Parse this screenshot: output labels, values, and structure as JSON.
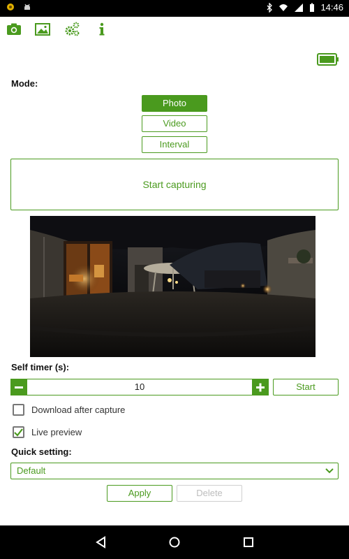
{
  "status_bar": {
    "time": "14:46"
  },
  "toolbar": {
    "icons": [
      "camera-icon",
      "gallery-icon",
      "settings-icon",
      "info-icon"
    ]
  },
  "mode": {
    "label": "Mode:",
    "options": [
      "Photo",
      "Video",
      "Interval"
    ],
    "selected": "Photo"
  },
  "capture": {
    "label": "Start capturing"
  },
  "self_timer": {
    "label": "Self timer (s):",
    "value": "10",
    "start_label": "Start"
  },
  "options": {
    "download_after_capture": {
      "label": "Download after capture",
      "checked": false
    },
    "live_preview": {
      "label": "Live preview",
      "checked": true
    }
  },
  "quick_setting": {
    "label": "Quick setting:",
    "selected": "Default",
    "apply_label": "Apply",
    "delete_label": "Delete"
  },
  "colors": {
    "accent": "#4a9a1e",
    "disabled": "#bdbdbd"
  }
}
